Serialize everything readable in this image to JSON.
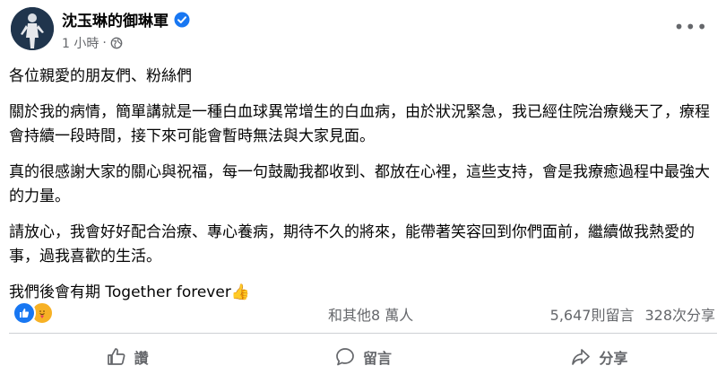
{
  "post": {
    "author": "沈玉琳的御琳軍",
    "time": "1 小時",
    "separator": "·",
    "more_label": "•••",
    "paragraphs": [
      "各位親愛的朋友們、粉絲們",
      "關於我的病情，簡單講就是一種白血球異常增生的白血病，由於狀況緊急，我已經住院治療幾天了，療程會持續一段時間，接下來可能會暫時無法與大家見面。",
      "真的很感謝大家的關心與祝福，每一句鼓勵我都收到、都放在心裡，這些支持，會是我療癒過程中最強大的力量。",
      "請放心，我會好好配合治療、專心養病，期待不久的將來，能帶著笑容回到你們面前，繼續做我熱愛的事，過我喜歡的生活。",
      "我們後會有期  Together forever👍"
    ]
  },
  "reactions": {
    "others": "和其他8 萬人",
    "comments": "5,647則留言",
    "shares": "328次分享"
  },
  "actions": {
    "like": "讚",
    "comment": "留言",
    "share": "分享"
  },
  "colors": {
    "verified": "#1877f2",
    "like_reaction": "#1877f2",
    "care_reaction": "#f7b125",
    "secondary_text": "#65676b"
  }
}
